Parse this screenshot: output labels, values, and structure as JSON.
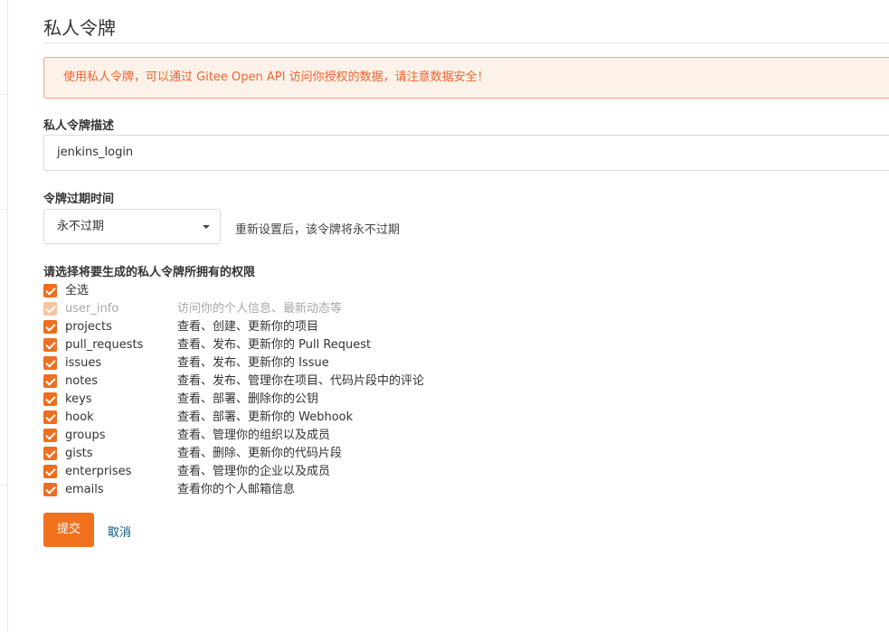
{
  "page": {
    "title": "私人令牌"
  },
  "notice": {
    "text": "使用私人令牌，可以通过 Gitee Open API 访问你授权的数据，请注意数据安全！"
  },
  "description": {
    "label": "私人令牌描述",
    "value": "jenkins_login"
  },
  "expiry": {
    "label": "令牌过期时间",
    "selected": "永不过期",
    "hint": "重新设置后，该令牌将永不过期"
  },
  "permissions": {
    "label": "请选择将要生成的私人令牌所拥有的权限",
    "select_all": {
      "label": "全选",
      "checked": true
    },
    "items": [
      {
        "name": "user_info",
        "desc": "访问你的个人信息、最新动态等",
        "checked": true,
        "disabled": true
      },
      {
        "name": "projects",
        "desc": "查看、创建、更新你的项目",
        "checked": true,
        "disabled": false
      },
      {
        "name": "pull_requests",
        "desc": "查看、发布、更新你的 Pull Request",
        "checked": true,
        "disabled": false
      },
      {
        "name": "issues",
        "desc": "查看、发布、更新你的 Issue",
        "checked": true,
        "disabled": false
      },
      {
        "name": "notes",
        "desc": "查看、发布、管理你在项目、代码片段中的评论",
        "checked": true,
        "disabled": false
      },
      {
        "name": "keys",
        "desc": "查看、部署、删除你的公钥",
        "checked": true,
        "disabled": false
      },
      {
        "name": "hook",
        "desc": "查看、部署、更新你的 Webhook",
        "checked": true,
        "disabled": false
      },
      {
        "name": "groups",
        "desc": "查看、管理你的组织以及成员",
        "checked": true,
        "disabled": false
      },
      {
        "name": "gists",
        "desc": "查看、删除、更新你的代码片段",
        "checked": true,
        "disabled": false
      },
      {
        "name": "enterprises",
        "desc": "查看、管理你的企业以及成员",
        "checked": true,
        "disabled": false
      },
      {
        "name": "emails",
        "desc": "查看你的个人邮箱信息",
        "checked": true,
        "disabled": false
      }
    ]
  },
  "actions": {
    "submit_label": "提交",
    "cancel_label": "取消"
  },
  "colors": {
    "accent": "#f2711c",
    "notice_bg": "#fdf2ea",
    "notice_text": "#f0642d",
    "link": "#005980"
  }
}
